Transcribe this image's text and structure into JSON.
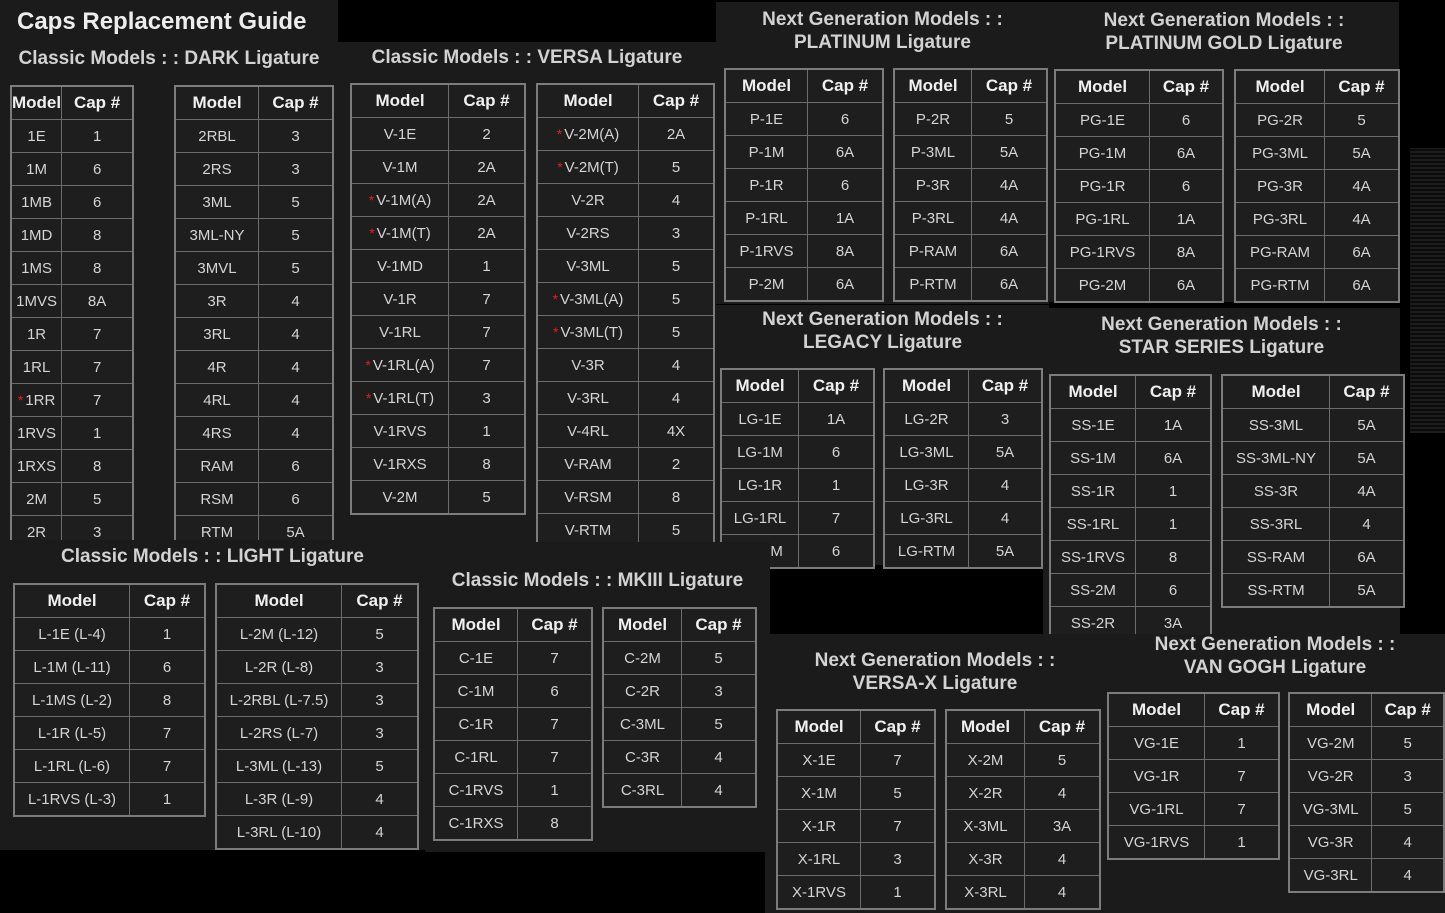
{
  "page_title": "Caps Replacement Guide",
  "headers": {
    "model": "Model",
    "cap": "Cap #"
  },
  "sections": [
    {
      "id": "dark",
      "title": [
        "Classic Models : : DARK Ligature"
      ],
      "tables": [
        [
          [
            "1E",
            "1"
          ],
          [
            "1M",
            "6"
          ],
          [
            "1MB",
            "6"
          ],
          [
            "1MD",
            "8"
          ],
          [
            "1MS",
            "8"
          ],
          [
            "1MVS",
            "8A"
          ],
          [
            "1R",
            "7"
          ],
          [
            "1RL",
            "7"
          ],
          [
            "*1RR",
            "7"
          ],
          [
            "1RVS",
            "1"
          ],
          [
            "1RXS",
            "8"
          ],
          [
            "2M",
            "5"
          ],
          [
            "2R",
            "3"
          ]
        ],
        [
          [
            "2RBL",
            "3"
          ],
          [
            "2RS",
            "3"
          ],
          [
            "3ML",
            "5"
          ],
          [
            "3ML-NY",
            "5"
          ],
          [
            "3MVL",
            "5"
          ],
          [
            "3R",
            "4"
          ],
          [
            "3RL",
            "4"
          ],
          [
            "4R",
            "4"
          ],
          [
            "4RL",
            "4"
          ],
          [
            "4RS",
            "4"
          ],
          [
            "RAM",
            "6"
          ],
          [
            "RSM",
            "6"
          ],
          [
            "RTM",
            "5A"
          ]
        ]
      ]
    },
    {
      "id": "versa",
      "title": [
        "Classic Models : : VERSA Ligature"
      ],
      "tables": [
        [
          [
            "V-1E",
            "2"
          ],
          [
            "V-1M",
            "2A"
          ],
          [
            "*V-1M(A)",
            "2A"
          ],
          [
            "*V-1M(T)",
            "2A"
          ],
          [
            "V-1MD",
            "1"
          ],
          [
            "V-1R",
            "7"
          ],
          [
            "V-1RL",
            "7"
          ],
          [
            "*V-1RL(A)",
            "7"
          ],
          [
            "*V-1RL(T)",
            "3"
          ],
          [
            "V-1RVS",
            "1"
          ],
          [
            "V-1RXS",
            "8"
          ],
          [
            "V-2M",
            "5"
          ]
        ],
        [
          [
            "*V-2M(A)",
            "2A"
          ],
          [
            "*V-2M(T)",
            "5"
          ],
          [
            "V-2R",
            "4"
          ],
          [
            "V-2RS",
            "3"
          ],
          [
            "V-3ML",
            "5"
          ],
          [
            "*V-3ML(A)",
            "5"
          ],
          [
            "*V-3ML(T)",
            "5"
          ],
          [
            "V-3R",
            "4"
          ],
          [
            "V-3RL",
            "4"
          ],
          [
            "V-4RL",
            "4X"
          ],
          [
            "V-RAM",
            "2"
          ],
          [
            "V-RSM",
            "8"
          ],
          [
            "V-RTM",
            "5"
          ]
        ]
      ]
    },
    {
      "id": "platinum",
      "title": [
        "Next Generation Models : :",
        "PLATINUM Ligature"
      ],
      "tables": [
        [
          [
            "P-1E",
            "6"
          ],
          [
            "P-1M",
            "6A"
          ],
          [
            "P-1R",
            "6"
          ],
          [
            "P-1RL",
            "1A"
          ],
          [
            "P-1RVS",
            "8A"
          ],
          [
            "P-2M",
            "6A"
          ]
        ],
        [
          [
            "P-2R",
            "5"
          ],
          [
            "P-3ML",
            "5A"
          ],
          [
            "P-3R",
            "4A"
          ],
          [
            "P-3RL",
            "4A"
          ],
          [
            "P-RAM",
            "6A"
          ],
          [
            "P-RTM",
            "6A"
          ]
        ]
      ]
    },
    {
      "id": "platinum-gold",
      "title": [
        "Next Generation Models : :",
        "PLATINUM GOLD Ligature"
      ],
      "tables": [
        [
          [
            "PG-1E",
            "6"
          ],
          [
            "PG-1M",
            "6A"
          ],
          [
            "PG-1R",
            "6"
          ],
          [
            "PG-1RL",
            "1A"
          ],
          [
            "PG-1RVS",
            "8A"
          ],
          [
            "PG-2M",
            "6A"
          ]
        ],
        [
          [
            "PG-2R",
            "5"
          ],
          [
            "PG-3ML",
            "5A"
          ],
          [
            "PG-3R",
            "4A"
          ],
          [
            "PG-3RL",
            "4A"
          ],
          [
            "PG-RAM",
            "6A"
          ],
          [
            "PG-RTM",
            "6A"
          ]
        ]
      ]
    },
    {
      "id": "legacy",
      "title": [
        "Next Generation Models : :",
        "LEGACY Ligature"
      ],
      "tables": [
        [
          [
            "LG-1E",
            "1A"
          ],
          [
            "LG-1M",
            "6"
          ],
          [
            "LG-1R",
            "1"
          ],
          [
            "LG-1RL",
            "7"
          ],
          [
            "LG-2M",
            "6"
          ]
        ],
        [
          [
            "LG-2R",
            "3"
          ],
          [
            "LG-3ML",
            "5A"
          ],
          [
            "LG-3R",
            "4"
          ],
          [
            "LG-3RL",
            "4"
          ],
          [
            "LG-RTM",
            "5A"
          ]
        ]
      ]
    },
    {
      "id": "star",
      "title": [
        "Next Generation Models : :",
        "STAR SERIES Ligature"
      ],
      "tables": [
        [
          [
            "SS-1E",
            "1A"
          ],
          [
            "SS-1M",
            "6A"
          ],
          [
            "SS-1R",
            "1"
          ],
          [
            "SS-1RL",
            "1"
          ],
          [
            "SS-1RVS",
            "8"
          ],
          [
            "SS-2M",
            "6"
          ],
          [
            "SS-2R",
            "3A"
          ]
        ],
        [
          [
            "SS-3ML",
            "5A"
          ],
          [
            "SS-3ML-NY",
            "5A"
          ],
          [
            "SS-3R",
            "4A"
          ],
          [
            "SS-3RL",
            "4"
          ],
          [
            "SS-RAM",
            "6A"
          ],
          [
            "SS-RTM",
            "5A"
          ]
        ]
      ]
    },
    {
      "id": "light",
      "title": [
        "Classic Models : : LIGHT Ligature"
      ],
      "tables": [
        [
          [
            "L-1E (L-4)",
            "1"
          ],
          [
            "L-1M (L-11)",
            "6"
          ],
          [
            "L-1MS (L-2)",
            "8"
          ],
          [
            "L-1R (L-5)",
            "7"
          ],
          [
            "L-1RL (L-6)",
            "7"
          ],
          [
            "L-1RVS (L-3)",
            "1"
          ]
        ],
        [
          [
            "L-2M (L-12)",
            "5"
          ],
          [
            "L-2R (L-8)",
            "3"
          ],
          [
            "L-2RBL (L-7.5)",
            "3"
          ],
          [
            "L-2RS (L-7)",
            "3"
          ],
          [
            "L-3ML (L-13)",
            "5"
          ],
          [
            "L-3R (L-9)",
            "4"
          ],
          [
            "L-3RL (L-10)",
            "4"
          ]
        ]
      ]
    },
    {
      "id": "mkiii",
      "title": [
        "Classic Models : : MKIII Ligature"
      ],
      "tables": [
        [
          [
            "C-1E",
            "7"
          ],
          [
            "C-1M",
            "6"
          ],
          [
            "C-1R",
            "7"
          ],
          [
            "C-1RL",
            "7"
          ],
          [
            "C-1RVS",
            "1"
          ],
          [
            "C-1RXS",
            "8"
          ]
        ],
        [
          [
            "C-2M",
            "5"
          ],
          [
            "C-2R",
            "3"
          ],
          [
            "C-3ML",
            "5"
          ],
          [
            "C-3R",
            "4"
          ],
          [
            "C-3RL",
            "4"
          ]
        ]
      ]
    },
    {
      "id": "versa-x",
      "title": [
        "Next Generation Models : :",
        "VERSA-X Ligature"
      ],
      "tables": [
        [
          [
            "X-1E",
            "7"
          ],
          [
            "X-1M",
            "5"
          ],
          [
            "X-1R",
            "7"
          ],
          [
            "X-1RL",
            "3"
          ],
          [
            "X-1RVS",
            "1"
          ]
        ],
        [
          [
            "X-2M",
            "5"
          ],
          [
            "X-2R",
            "4"
          ],
          [
            "X-3ML",
            "3A"
          ],
          [
            "X-3R",
            "4"
          ],
          [
            "X-3RL",
            "4"
          ]
        ]
      ]
    },
    {
      "id": "van-gogh",
      "title": [
        "Next Generation Models : :",
        "VAN GOGH Ligature"
      ],
      "tables": [
        [
          [
            "VG-1E",
            "1"
          ],
          [
            "VG-1R",
            "7"
          ],
          [
            "VG-1RL",
            "7"
          ],
          [
            "VG-1RVS",
            "1"
          ]
        ],
        [
          [
            "VG-2M",
            "5"
          ],
          [
            "VG-2R",
            "3"
          ],
          [
            "VG-3ML",
            "5"
          ],
          [
            "VG-3R",
            "4"
          ],
          [
            "VG-3RL",
            "4"
          ]
        ]
      ]
    }
  ]
}
